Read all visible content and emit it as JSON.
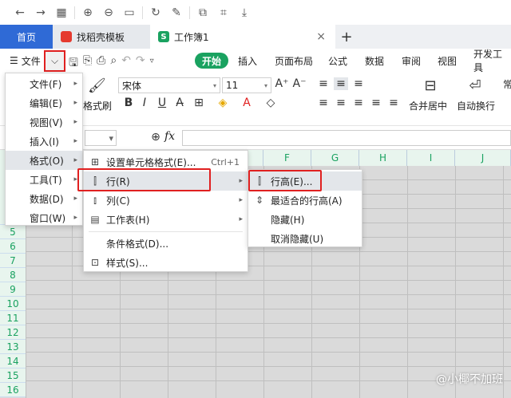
{
  "tabs": {
    "home": "首页",
    "find_template": "找稻壳模板",
    "doc": "工作簿1",
    "doc_logo": "S",
    "close": "×",
    "add": "+"
  },
  "menubar": {
    "file": "文件",
    "tabs": [
      "开始",
      "插入",
      "页面布局",
      "公式",
      "数据",
      "审阅",
      "视图",
      "开发工具"
    ]
  },
  "ribbon": {
    "format_painter": "格式刷",
    "font_name": "宋体",
    "font_size": "11",
    "merge_center": "合并居中",
    "auto_wrap": "自动换行",
    "normal": "常"
  },
  "formula": {
    "fx": "fx"
  },
  "columns": [
    "F",
    "G",
    "H",
    "I",
    "J"
  ],
  "rows": [
    "5",
    "6",
    "7",
    "8",
    "9",
    "10",
    "11",
    "12",
    "13",
    "14",
    "15",
    "16"
  ],
  "file_menu": {
    "items": [
      "文件(F)",
      "编辑(E)",
      "视图(V)",
      "插入(I)",
      "格式(O)",
      "工具(T)",
      "数据(D)",
      "窗口(W)"
    ]
  },
  "format_menu": {
    "cell_format": "设置单元格格式(E)...",
    "cell_format_shortcut": "Ctrl+1",
    "row": "行(R)",
    "column": "列(C)",
    "sheet": "工作表(H)",
    "conditional": "条件格式(D)...",
    "style": "样式(S)..."
  },
  "row_menu": {
    "row_height": "行高(E)...",
    "best_fit": "最适合的行高(A)",
    "hide": "隐藏(H)",
    "unhide": "取消隐藏(U)"
  },
  "watermark": "@小椰不加班",
  "colors": {
    "accent": "#1aa260",
    "highlight_box": "#e02020",
    "home_tab": "#2f6ad6"
  }
}
